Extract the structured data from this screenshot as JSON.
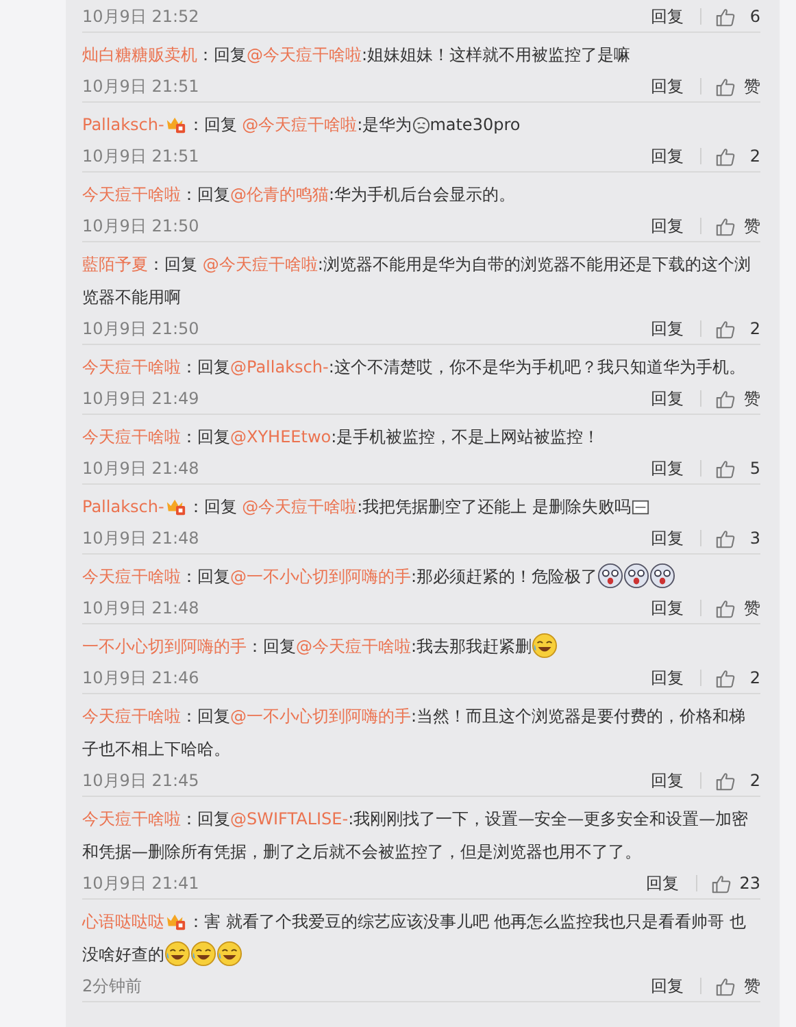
{
  "top_meta": {
    "time": "10月9日 21:52",
    "reply": "回复",
    "likes": "6"
  },
  "comments": [
    {
      "user": "灿白糖糖贩卖机",
      "badge": false,
      "body": [
        {
          "kind": "text",
          "text": "：回复"
        },
        {
          "kind": "mention",
          "text": "@今天痘干啥啦"
        },
        {
          "kind": "text",
          "text": ":姐妹姐妹！这样就不用被监控了是嘛"
        }
      ],
      "time": "10月9日 21:51",
      "reply": "回复",
      "likes": "赞"
    },
    {
      "user": "Pallaksch-",
      "badge": true,
      "body": [
        {
          "kind": "text",
          "text": "：回复 "
        },
        {
          "kind": "mention",
          "text": "@今天痘干啥啦"
        },
        {
          "kind": "text",
          "text": ":是华为"
        },
        {
          "kind": "face"
        },
        {
          "kind": "text",
          "text": "mate30pro"
        }
      ],
      "time": "10月9日 21:51",
      "reply": "回复",
      "likes": "2"
    },
    {
      "user": "今天痘干啥啦",
      "badge": false,
      "body": [
        {
          "kind": "text",
          "text": "：回复"
        },
        {
          "kind": "mention",
          "text": "@伦青的鸣猫"
        },
        {
          "kind": "text",
          "text": ":华为手机后台会显示的。"
        }
      ],
      "time": "10月9日 21:50",
      "reply": "回复",
      "likes": "赞"
    },
    {
      "user": "藍陌予夏",
      "badge": false,
      "body": [
        {
          "kind": "text",
          "text": "：回复 "
        },
        {
          "kind": "mention",
          "text": "@今天痘干啥啦"
        },
        {
          "kind": "text",
          "text": ":浏览器不能用是华为自带的浏览器不能用还是下载的这个浏览器不能用啊"
        }
      ],
      "time": "10月9日 21:50",
      "reply": "回复",
      "likes": "2"
    },
    {
      "user": "今天痘干啥啦",
      "badge": false,
      "body": [
        {
          "kind": "text",
          "text": "：回复"
        },
        {
          "kind": "mention",
          "text": "@Pallaksch-"
        },
        {
          "kind": "text",
          "text": ":这个不清楚哎，你不是华为手机吧？我只知道华为手机。"
        }
      ],
      "time": "10月9日 21:49",
      "reply": "回复",
      "likes": "赞"
    },
    {
      "user": "今天痘干啥啦",
      "badge": false,
      "body": [
        {
          "kind": "text",
          "text": "：回复"
        },
        {
          "kind": "mention",
          "text": "@XYHEEtwo"
        },
        {
          "kind": "text",
          "text": ":是手机被监控，不是上网站被监控！"
        }
      ],
      "time": "10月9日 21:48",
      "reply": "回复",
      "likes": "5"
    },
    {
      "user": "Pallaksch-",
      "badge": true,
      "body": [
        {
          "kind": "text",
          "text": "：回复 "
        },
        {
          "kind": "mention",
          "text": "@今天痘干啥啦"
        },
        {
          "kind": "text",
          "text": ":我把凭据删空了还能上 是删除失败吗"
        },
        {
          "kind": "square"
        }
      ],
      "time": "10月9日 21:48",
      "reply": "回复",
      "likes": "3"
    },
    {
      "user": "今天痘干啥啦",
      "badge": false,
      "body": [
        {
          "kind": "text",
          "text": "：回复"
        },
        {
          "kind": "mention",
          "text": "@一不小心切到阿嗨的手"
        },
        {
          "kind": "text",
          "text": ":那必须赶紧的！危险极了"
        },
        {
          "kind": "scared"
        },
        {
          "kind": "scared"
        },
        {
          "kind": "scared"
        }
      ],
      "time": "10月9日 21:48",
      "reply": "回复",
      "likes": "赞"
    },
    {
      "user": "一不小心切到阿嗨的手",
      "badge": false,
      "body": [
        {
          "kind": "text",
          "text": "：回复"
        },
        {
          "kind": "mention",
          "text": "@今天痘干啥啦"
        },
        {
          "kind": "text",
          "text": ":我去那我赶紧删"
        },
        {
          "kind": "laugh"
        }
      ],
      "time": "10月9日 21:46",
      "reply": "回复",
      "likes": "2"
    },
    {
      "user": "今天痘干啥啦",
      "badge": false,
      "body": [
        {
          "kind": "text",
          "text": "：回复"
        },
        {
          "kind": "mention",
          "text": "@一不小心切到阿嗨的手"
        },
        {
          "kind": "text",
          "text": ":当然！而且这个浏览器是要付费的，价格和梯子也不相上下哈哈。"
        }
      ],
      "time": "10月9日 21:45",
      "reply": "回复",
      "likes": "2"
    },
    {
      "user": "今天痘干啥啦",
      "badge": false,
      "body": [
        {
          "kind": "text",
          "text": "：回复"
        },
        {
          "kind": "mention",
          "text": "@SWIFTALISE-"
        },
        {
          "kind": "text",
          "text": ":我刚刚找了一下，设置—安全—更多安全和设置—加密和凭据—删除所有凭据，删了之后就不会被监控了，但是浏览器也用不了了。"
        }
      ],
      "time": "10月9日 21:41",
      "reply": "回复",
      "likes": "23"
    },
    {
      "user": "心语哒哒哒",
      "badge": true,
      "body": [
        {
          "kind": "text",
          "text": "：害 就看了个我爱豆的综艺应该没事儿吧 他再怎么监控我也只是看看帅哥 也没啥好查的"
        },
        {
          "kind": "laugh"
        },
        {
          "kind": "laugh"
        },
        {
          "kind": "laugh"
        }
      ],
      "time": "2分钟前",
      "reply": "回复",
      "likes": "赞"
    }
  ]
}
